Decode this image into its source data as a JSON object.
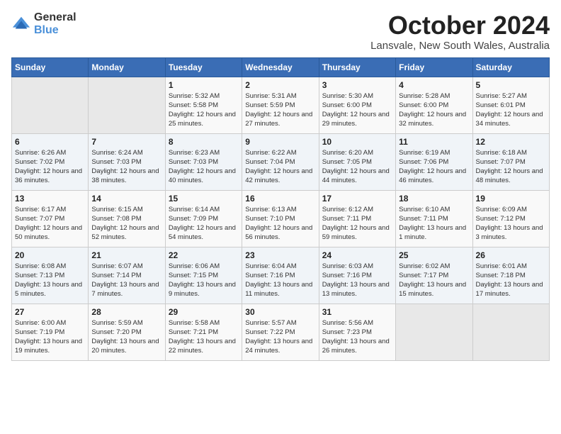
{
  "header": {
    "logo": {
      "general": "General",
      "blue": "Blue"
    },
    "title": "October 2024",
    "location": "Lansvale, New South Wales, Australia"
  },
  "days_of_week": [
    "Sunday",
    "Monday",
    "Tuesday",
    "Wednesday",
    "Thursday",
    "Friday",
    "Saturday"
  ],
  "weeks": [
    [
      {
        "day": "",
        "empty": true
      },
      {
        "day": "",
        "empty": true
      },
      {
        "day": "1",
        "sunrise": "Sunrise: 5:32 AM",
        "sunset": "Sunset: 5:58 PM",
        "daylight": "Daylight: 12 hours and 25 minutes."
      },
      {
        "day": "2",
        "sunrise": "Sunrise: 5:31 AM",
        "sunset": "Sunset: 5:59 PM",
        "daylight": "Daylight: 12 hours and 27 minutes."
      },
      {
        "day": "3",
        "sunrise": "Sunrise: 5:30 AM",
        "sunset": "Sunset: 6:00 PM",
        "daylight": "Daylight: 12 hours and 29 minutes."
      },
      {
        "day": "4",
        "sunrise": "Sunrise: 5:28 AM",
        "sunset": "Sunset: 6:00 PM",
        "daylight": "Daylight: 12 hours and 32 minutes."
      },
      {
        "day": "5",
        "sunrise": "Sunrise: 5:27 AM",
        "sunset": "Sunset: 6:01 PM",
        "daylight": "Daylight: 12 hours and 34 minutes."
      }
    ],
    [
      {
        "day": "6",
        "sunrise": "Sunrise: 6:26 AM",
        "sunset": "Sunset: 7:02 PM",
        "daylight": "Daylight: 12 hours and 36 minutes."
      },
      {
        "day": "7",
        "sunrise": "Sunrise: 6:24 AM",
        "sunset": "Sunset: 7:03 PM",
        "daylight": "Daylight: 12 hours and 38 minutes."
      },
      {
        "day": "8",
        "sunrise": "Sunrise: 6:23 AM",
        "sunset": "Sunset: 7:03 PM",
        "daylight": "Daylight: 12 hours and 40 minutes."
      },
      {
        "day": "9",
        "sunrise": "Sunrise: 6:22 AM",
        "sunset": "Sunset: 7:04 PM",
        "daylight": "Daylight: 12 hours and 42 minutes."
      },
      {
        "day": "10",
        "sunrise": "Sunrise: 6:20 AM",
        "sunset": "Sunset: 7:05 PM",
        "daylight": "Daylight: 12 hours and 44 minutes."
      },
      {
        "day": "11",
        "sunrise": "Sunrise: 6:19 AM",
        "sunset": "Sunset: 7:06 PM",
        "daylight": "Daylight: 12 hours and 46 minutes."
      },
      {
        "day": "12",
        "sunrise": "Sunrise: 6:18 AM",
        "sunset": "Sunset: 7:07 PM",
        "daylight": "Daylight: 12 hours and 48 minutes."
      }
    ],
    [
      {
        "day": "13",
        "sunrise": "Sunrise: 6:17 AM",
        "sunset": "Sunset: 7:07 PM",
        "daylight": "Daylight: 12 hours and 50 minutes."
      },
      {
        "day": "14",
        "sunrise": "Sunrise: 6:15 AM",
        "sunset": "Sunset: 7:08 PM",
        "daylight": "Daylight: 12 hours and 52 minutes."
      },
      {
        "day": "15",
        "sunrise": "Sunrise: 6:14 AM",
        "sunset": "Sunset: 7:09 PM",
        "daylight": "Daylight: 12 hours and 54 minutes."
      },
      {
        "day": "16",
        "sunrise": "Sunrise: 6:13 AM",
        "sunset": "Sunset: 7:10 PM",
        "daylight": "Daylight: 12 hours and 56 minutes."
      },
      {
        "day": "17",
        "sunrise": "Sunrise: 6:12 AM",
        "sunset": "Sunset: 7:11 PM",
        "daylight": "Daylight: 12 hours and 59 minutes."
      },
      {
        "day": "18",
        "sunrise": "Sunrise: 6:10 AM",
        "sunset": "Sunset: 7:11 PM",
        "daylight": "Daylight: 13 hours and 1 minute."
      },
      {
        "day": "19",
        "sunrise": "Sunrise: 6:09 AM",
        "sunset": "Sunset: 7:12 PM",
        "daylight": "Daylight: 13 hours and 3 minutes."
      }
    ],
    [
      {
        "day": "20",
        "sunrise": "Sunrise: 6:08 AM",
        "sunset": "Sunset: 7:13 PM",
        "daylight": "Daylight: 13 hours and 5 minutes."
      },
      {
        "day": "21",
        "sunrise": "Sunrise: 6:07 AM",
        "sunset": "Sunset: 7:14 PM",
        "daylight": "Daylight: 13 hours and 7 minutes."
      },
      {
        "day": "22",
        "sunrise": "Sunrise: 6:06 AM",
        "sunset": "Sunset: 7:15 PM",
        "daylight": "Daylight: 13 hours and 9 minutes."
      },
      {
        "day": "23",
        "sunrise": "Sunrise: 6:04 AM",
        "sunset": "Sunset: 7:16 PM",
        "daylight": "Daylight: 13 hours and 11 minutes."
      },
      {
        "day": "24",
        "sunrise": "Sunrise: 6:03 AM",
        "sunset": "Sunset: 7:16 PM",
        "daylight": "Daylight: 13 hours and 13 minutes."
      },
      {
        "day": "25",
        "sunrise": "Sunrise: 6:02 AM",
        "sunset": "Sunset: 7:17 PM",
        "daylight": "Daylight: 13 hours and 15 minutes."
      },
      {
        "day": "26",
        "sunrise": "Sunrise: 6:01 AM",
        "sunset": "Sunset: 7:18 PM",
        "daylight": "Daylight: 13 hours and 17 minutes."
      }
    ],
    [
      {
        "day": "27",
        "sunrise": "Sunrise: 6:00 AM",
        "sunset": "Sunset: 7:19 PM",
        "daylight": "Daylight: 13 hours and 19 minutes."
      },
      {
        "day": "28",
        "sunrise": "Sunrise: 5:59 AM",
        "sunset": "Sunset: 7:20 PM",
        "daylight": "Daylight: 13 hours and 20 minutes."
      },
      {
        "day": "29",
        "sunrise": "Sunrise: 5:58 AM",
        "sunset": "Sunset: 7:21 PM",
        "daylight": "Daylight: 13 hours and 22 minutes."
      },
      {
        "day": "30",
        "sunrise": "Sunrise: 5:57 AM",
        "sunset": "Sunset: 7:22 PM",
        "daylight": "Daylight: 13 hours and 24 minutes."
      },
      {
        "day": "31",
        "sunrise": "Sunrise: 5:56 AM",
        "sunset": "Sunset: 7:23 PM",
        "daylight": "Daylight: 13 hours and 26 minutes."
      },
      {
        "day": "",
        "empty": true
      },
      {
        "day": "",
        "empty": true
      }
    ]
  ]
}
